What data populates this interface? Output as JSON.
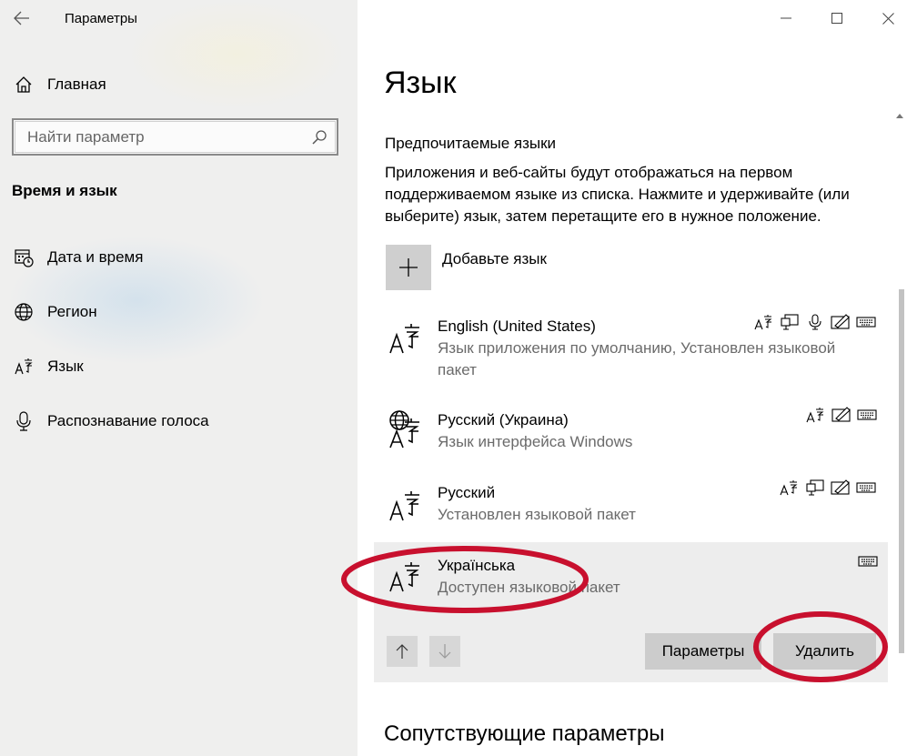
{
  "window": {
    "title": "Параметры",
    "back_icon": "back-arrow-icon",
    "controls": [
      "minimize-icon",
      "maximize-icon",
      "close-icon"
    ]
  },
  "sidebar": {
    "home_label": "Главная",
    "search_placeholder": "Найти параметр",
    "section_title": "Время и язык",
    "items": [
      {
        "label": "Дата и время",
        "icon": "calendar-clock-icon"
      },
      {
        "label": "Регион",
        "icon": "globe-icon"
      },
      {
        "label": "Язык",
        "icon": "language-icon"
      },
      {
        "label": "Распознавание голоса",
        "icon": "microphone-icon"
      }
    ]
  },
  "main": {
    "title": "Язык",
    "preferred_heading": "Предпочитаемые языки",
    "description_lines": [
      "Приложения и веб-сайты будут отображаться на первом",
      "поддерживаемом языке из списка. Нажмите и удерживайте (или",
      "выберите) язык, затем перетащите его в нужное положение."
    ],
    "add_language_label": "Добавьте язык",
    "languages": [
      {
        "name": "English (United States)",
        "sub_lines": [
          "Язык приложения по умолчанию, Установлен языковой",
          "пакет"
        ],
        "features": [
          "text-to-speech-icon",
          "display-icon",
          "microphone-icon",
          "handwriting-icon",
          "keyboard-icon"
        ]
      },
      {
        "name": "Русский (Украина)",
        "sub_lines": [
          "Язык интерфейса Windows"
        ],
        "features": [
          "text-to-speech-icon",
          "handwriting-icon",
          "keyboard-icon"
        ]
      },
      {
        "name": "Русский",
        "sub_lines": [
          "Установлен языковой пакет"
        ],
        "features": [
          "text-to-speech-icon",
          "display-icon",
          "handwriting-icon",
          "keyboard-icon"
        ]
      },
      {
        "name": "Українська",
        "sub_lines": [
          "Доступен языковой пакет"
        ],
        "features": [
          "keyboard-icon"
        ],
        "selected": true
      }
    ],
    "buttons": {
      "options": "Параметры",
      "remove": "Удалить"
    },
    "related_heading": "Сопутствующие параметры"
  },
  "colors": {
    "annotation_red": "#c8102e",
    "selected_bg": "#ededed",
    "button_bg": "#cccccc"
  }
}
